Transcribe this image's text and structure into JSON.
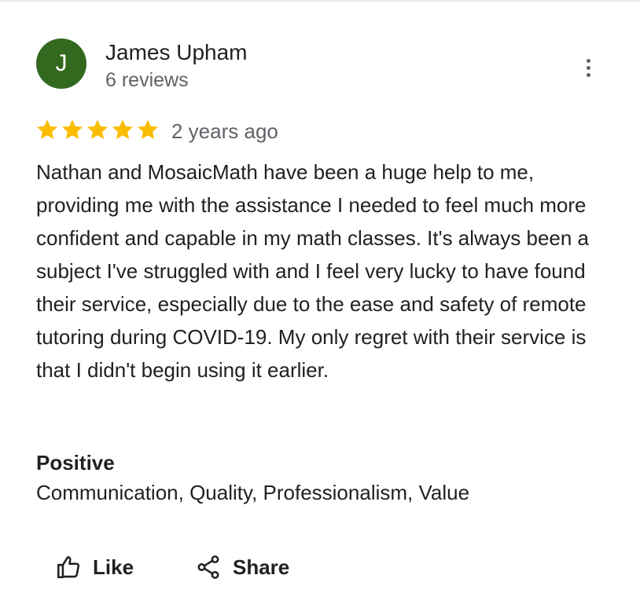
{
  "review": {
    "avatar_letter": "J",
    "avatar_color": "#33691e",
    "reviewer_name": "James Upham",
    "review_count": "6 reviews",
    "rating": 5,
    "rating_max": 5,
    "star_color": "#fbbc04",
    "age": "2 years ago",
    "text": "Nathan and MosaicMath have been a huge help to me, providing me with the assistance I needed to feel much more confident and capable in my math classes. It's always been a subject I've struggled with and I feel very lucky to have found their service, especially due to the ease and safety of remote tutoring during COVID-19. My only regret with their service is that I didn't begin using it earlier.",
    "positive_heading": "Positive",
    "positive_values": "Communication, Quality, Professionalism, Value"
  },
  "actions": {
    "like_label": "Like",
    "like_icon": "thumbs-up-icon",
    "share_label": "Share",
    "share_icon": "share-icon",
    "more_icon": "more-vert-icon"
  }
}
